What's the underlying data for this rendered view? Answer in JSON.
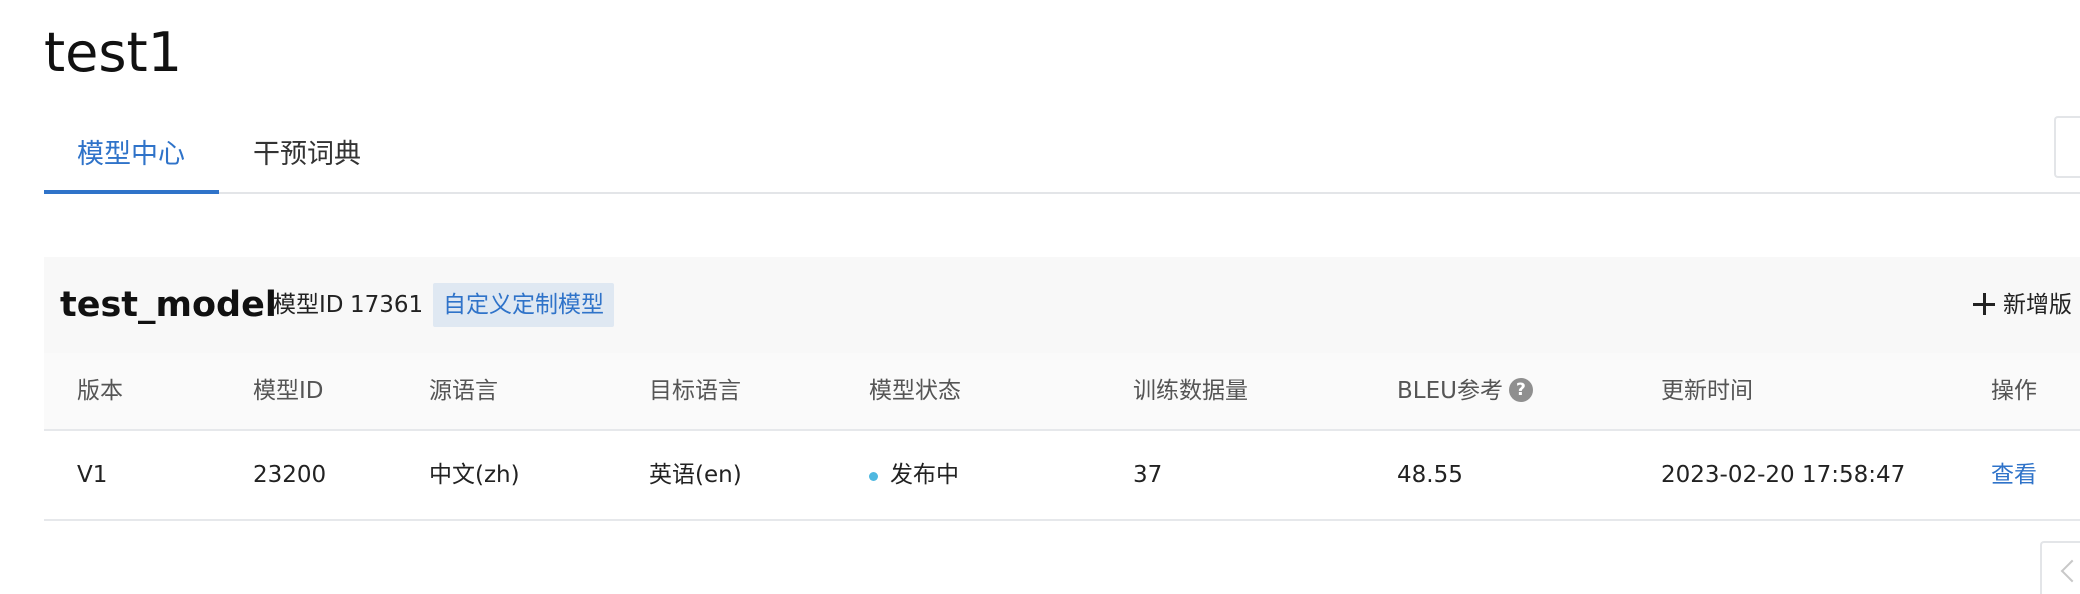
{
  "page": {
    "title": "test1"
  },
  "tabs": [
    {
      "label": "模型中心",
      "active": true
    },
    {
      "label": "干预词典",
      "active": false
    }
  ],
  "model": {
    "name": "test_model",
    "id_label": "模型ID",
    "id_value": "17361",
    "type_tag": "自定义定制模型",
    "add_version_label": "新增版"
  },
  "table": {
    "columns": [
      "版本",
      "模型ID",
      "源语言",
      "目标语言",
      "模型状态",
      "训练数据量",
      "BLEU参考",
      "更新时间",
      "操作"
    ],
    "rows": [
      {
        "version": "V1",
        "model_id": "23200",
        "source_lang": "中文(zh)",
        "target_lang": "英语(en)",
        "status": "发布中",
        "training_volume": "37",
        "bleu": "48.55",
        "updated": "2023-02-20 17:58:47",
        "action": "查看"
      }
    ]
  },
  "icons": {
    "help": "?",
    "add": "plus-icon",
    "collapse": "chevron-left-icon"
  },
  "colors": {
    "accent": "#2f73c9",
    "status_publishing": "#4fb8e0",
    "tag_background": "#dfe8f2"
  }
}
